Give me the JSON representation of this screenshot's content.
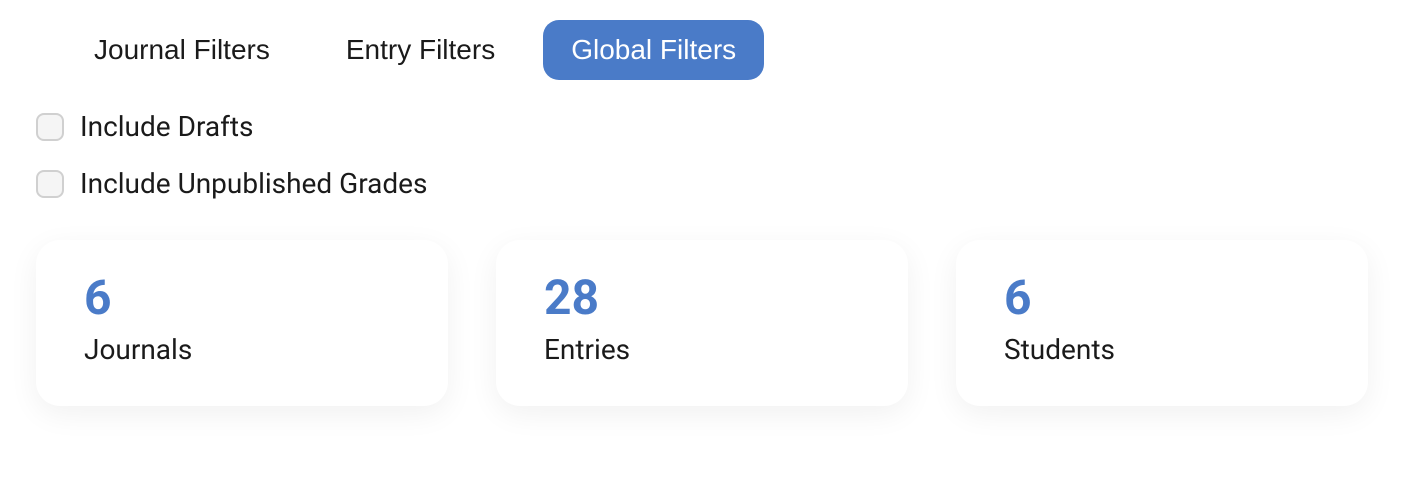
{
  "tabs": {
    "items": [
      {
        "label": "Journal Filters",
        "active": false
      },
      {
        "label": "Entry Filters",
        "active": false
      },
      {
        "label": "Global Filters",
        "active": true
      }
    ]
  },
  "checkboxes": {
    "drafts": {
      "label": "Include Drafts",
      "checked": false
    },
    "unpublished": {
      "label": "Include Unpublished Grades",
      "checked": false
    }
  },
  "stats": {
    "journals": {
      "value": "6",
      "label": "Journals"
    },
    "entries": {
      "value": "28",
      "label": "Entries"
    },
    "students": {
      "value": "6",
      "label": "Students"
    }
  },
  "colors": {
    "accent": "#4a7bc8"
  }
}
